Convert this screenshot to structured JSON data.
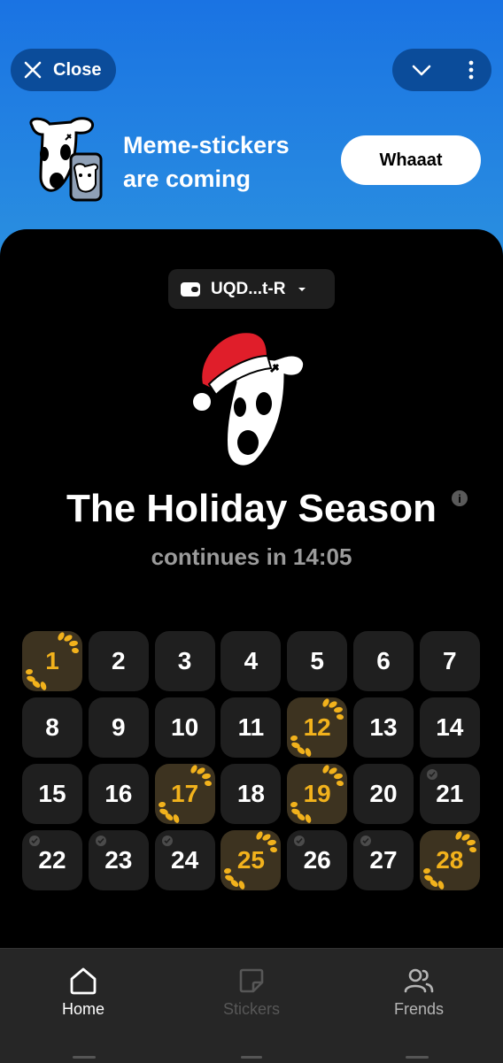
{
  "header": {
    "close_label": "Close",
    "icons": [
      "close-icon",
      "chevron-down-icon",
      "more-vertical-icon"
    ]
  },
  "banner": {
    "line1": "Meme-stickers",
    "line2": "are coming",
    "button_label": "Whaaat"
  },
  "wallet": {
    "address": "UQD...t-R",
    "icon": "wallet-icon"
  },
  "main": {
    "title": "The Holiday Season",
    "subtitle": "continues in 14:05",
    "info_icon": "i"
  },
  "calendar": {
    "days": [
      {
        "n": "1",
        "state": "reward"
      },
      {
        "n": "2",
        "state": "normal"
      },
      {
        "n": "3",
        "state": "normal"
      },
      {
        "n": "4",
        "state": "normal"
      },
      {
        "n": "5",
        "state": "normal"
      },
      {
        "n": "6",
        "state": "normal"
      },
      {
        "n": "7",
        "state": "normal"
      },
      {
        "n": "8",
        "state": "normal"
      },
      {
        "n": "9",
        "state": "normal"
      },
      {
        "n": "10",
        "state": "normal"
      },
      {
        "n": "11",
        "state": "normal"
      },
      {
        "n": "12",
        "state": "reward"
      },
      {
        "n": "13",
        "state": "normal"
      },
      {
        "n": "14",
        "state": "normal"
      },
      {
        "n": "15",
        "state": "normal"
      },
      {
        "n": "16",
        "state": "normal"
      },
      {
        "n": "17",
        "state": "reward"
      },
      {
        "n": "18",
        "state": "normal"
      },
      {
        "n": "19",
        "state": "reward"
      },
      {
        "n": "20",
        "state": "normal"
      },
      {
        "n": "21",
        "state": "checked"
      },
      {
        "n": "22",
        "state": "checked"
      },
      {
        "n": "23",
        "state": "checked"
      },
      {
        "n": "24",
        "state": "checked"
      },
      {
        "n": "25",
        "state": "reward"
      },
      {
        "n": "26",
        "state": "checked"
      },
      {
        "n": "27",
        "state": "checked"
      },
      {
        "n": "28",
        "state": "reward"
      }
    ],
    "colors": {
      "reward_text": "#f2b21c",
      "reward_bg": "#3d3320",
      "normal_bg": "#1f1f1f"
    }
  },
  "nav": {
    "items": [
      {
        "label": "Home",
        "icon": "home-icon",
        "active": true
      },
      {
        "label": "Stickers",
        "icon": "sticker-icon",
        "active": false
      },
      {
        "label": "Frends",
        "icon": "friends-icon",
        "active": false
      }
    ]
  },
  "colors": {
    "accent_blue": "#1a73e3",
    "pill_blue": "#0b4c9a"
  }
}
